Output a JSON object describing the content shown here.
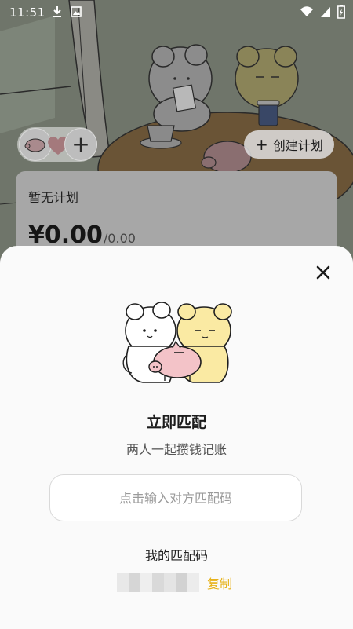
{
  "status_bar": {
    "time": "11:51",
    "icons": [
      "download-icon",
      "photo-icon",
      "wifi-icon",
      "signal-icon",
      "battery-icon"
    ]
  },
  "home": {
    "create_plan_button": "创建计划",
    "plan_card": {
      "title": "暂无计划",
      "amount": "¥0.00",
      "target": "/0.00"
    }
  },
  "match_sheet": {
    "title": "立即匹配",
    "subtitle": "两人一起攒钱记账",
    "input_placeholder": "点击输入对方匹配码",
    "my_code_label": "我的匹配码",
    "copy_label": "复制"
  },
  "colors": {
    "accent": "#e7b21a",
    "sheet_bg": "#fafafa",
    "pig_pink": "#f3c3c8",
    "bear_yellow": "#faeaa3"
  }
}
